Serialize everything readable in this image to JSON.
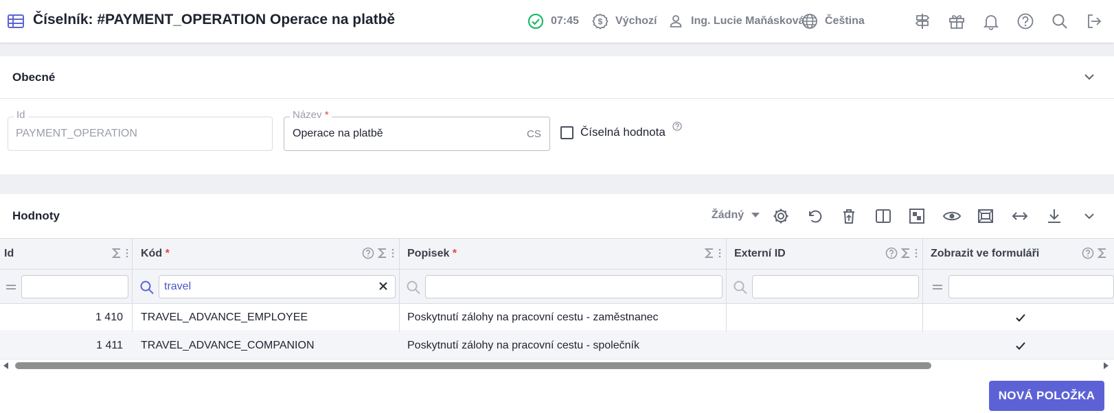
{
  "header": {
    "title": "Číselník: #PAYMENT_OPERATION Operace na platbě",
    "time": "07:45",
    "currency": "Výchozí",
    "user": "Ing. Lucie Maňásková",
    "language": "Čeština"
  },
  "general": {
    "title": "Obecné",
    "id_label": "Id",
    "id_value": "PAYMENT_OPERATION",
    "name_label": "Název",
    "name_required": "*",
    "name_value": "Operace na platbě",
    "name_lang": "CS",
    "numeric_label": "Číselná hodnota"
  },
  "values": {
    "title": "Hodnoty",
    "group_select": "Žádný",
    "columns": [
      {
        "label": "Id",
        "required": ""
      },
      {
        "label": "Kód",
        "required": "*"
      },
      {
        "label": "Popisek",
        "required": "*"
      },
      {
        "label": "Externí ID",
        "required": ""
      },
      {
        "label": "Zobrazit ve formuláři",
        "required": ""
      }
    ],
    "filters": {
      "code": "travel"
    },
    "rows": [
      {
        "id": "1 410",
        "code": "TRAVEL_ADVANCE_EMPLOYEE",
        "label": "Poskytnutí zálohy na pracovní cestu - zaměstnanec",
        "external_id": "",
        "show_in_form": true
      },
      {
        "id": "1 411",
        "code": "TRAVEL_ADVANCE_COMPANION",
        "label": "Poskytnutí zálohy na pracovní cestu - společník",
        "external_id": "",
        "show_in_form": true
      }
    ],
    "new_item_button": "NOVÁ POLOŽKA"
  },
  "colors": {
    "accent": "#5c62d6",
    "success": "#1fb86a",
    "required": "#e0483e"
  },
  "icons": [
    "table-icon",
    "check-circle-icon",
    "currency-icon",
    "user-icon",
    "globe-icon",
    "signpost-icon",
    "gift-icon",
    "bell-icon",
    "help-icon",
    "search-icon",
    "logout-icon",
    "chevron-down-icon",
    "gear-icon",
    "undo-icon",
    "delete-icon",
    "columns-icon",
    "density-icon",
    "eye-icon",
    "fit-icon",
    "width-icon",
    "download-icon",
    "sigma-icon",
    "filter-icon",
    "clear-icon",
    "check-icon"
  ]
}
